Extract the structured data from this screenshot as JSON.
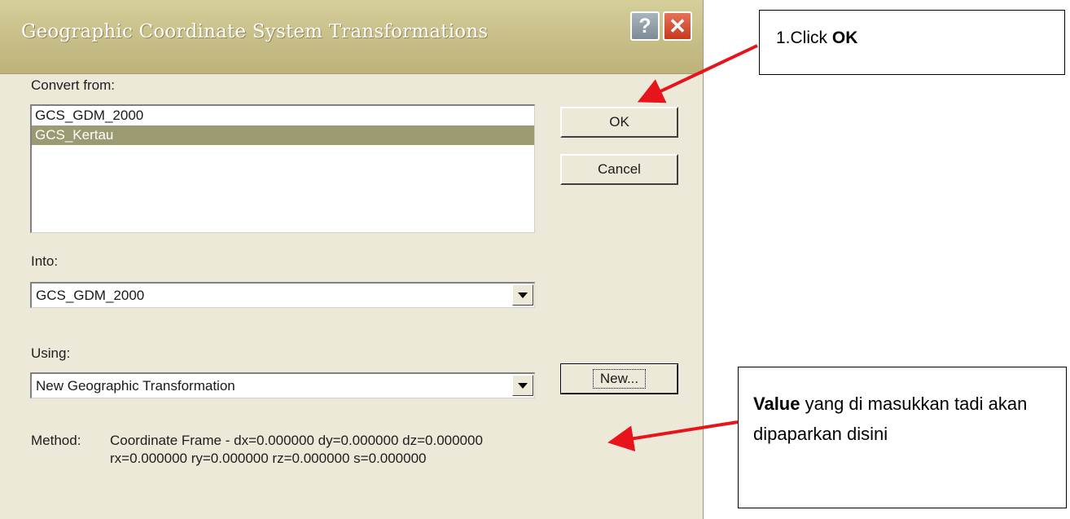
{
  "dialog": {
    "title": "Geographic Coordinate System Transformations",
    "help_label": "?",
    "close_label": "✕",
    "convert_from": {
      "label": "Convert from:",
      "items": [
        "GCS_GDM_2000",
        "GCS_Kertau"
      ],
      "selected": "GCS_Kertau"
    },
    "into": {
      "label": "Into:",
      "value": "GCS_GDM_2000"
    },
    "using": {
      "label": "Using:",
      "value": "New Geographic Transformation"
    },
    "buttons": {
      "ok": "OK",
      "cancel": "Cancel",
      "new": "New..."
    },
    "method": {
      "label": "Method:",
      "line1": "Coordinate Frame - dx=0.000000 dy=0.000000 dz=0.000000",
      "line2": "rx=0.000000 ry=0.000000 rz=0.000000 s=0.000000"
    }
  },
  "annotations": {
    "ok_callout": {
      "prefix": "1.Click ",
      "bold": "OK"
    },
    "value_callout": {
      "bold": "Value",
      "text": " yang di masukkan tadi akan dipaparkan disini"
    },
    "arrow_color": "#e8141b"
  }
}
